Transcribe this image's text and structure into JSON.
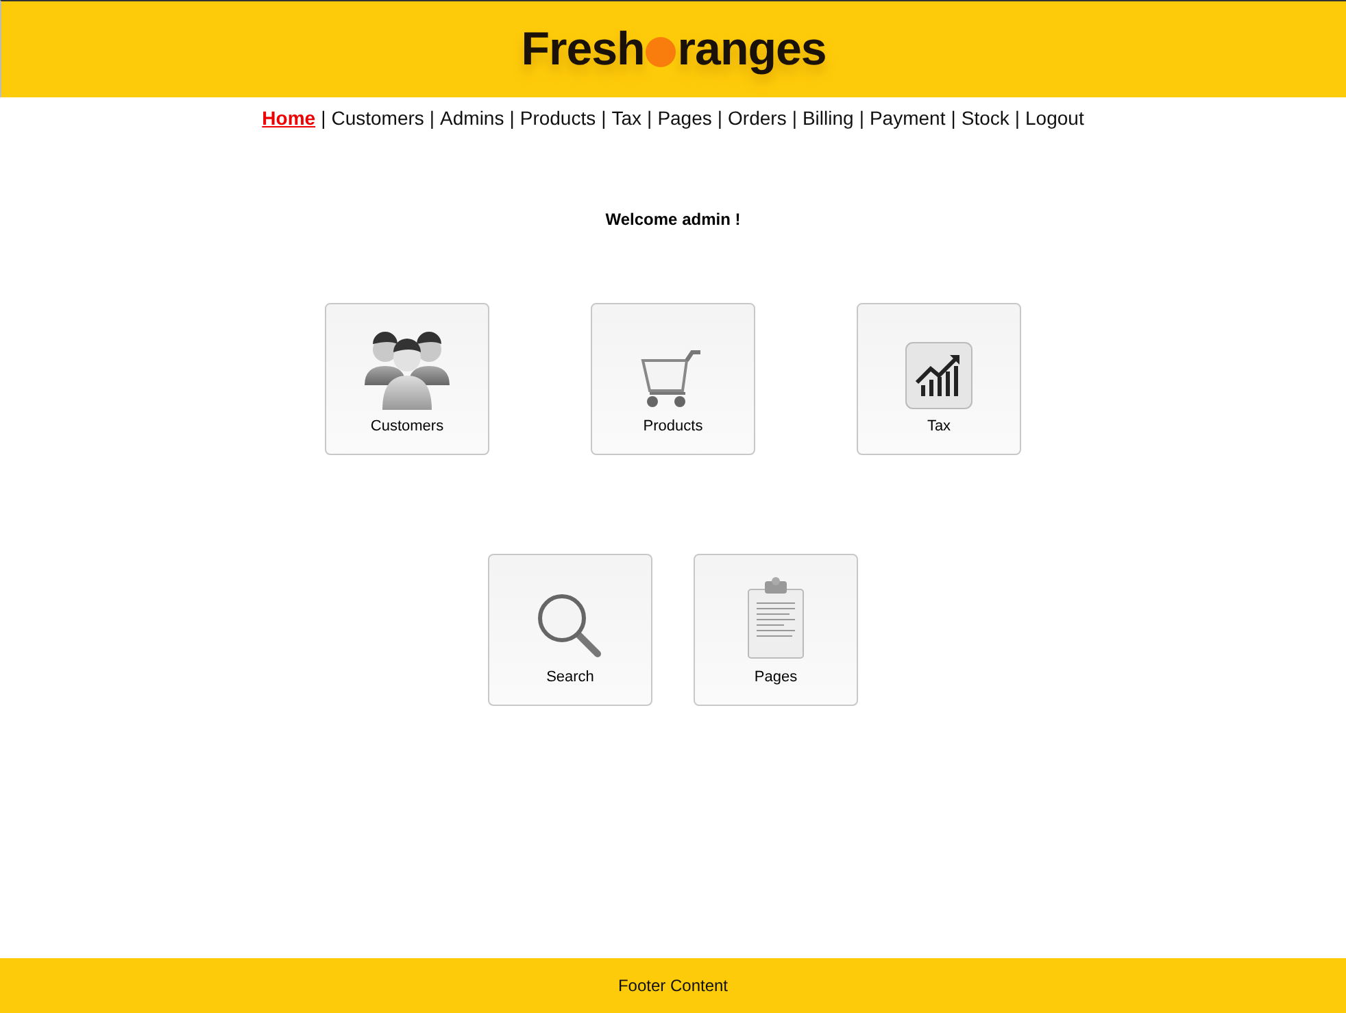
{
  "header": {
    "logo": {
      "before_dot": "Fresh",
      "after_dot": "ranges"
    }
  },
  "nav": {
    "separator": "|",
    "items": [
      {
        "label": "Home",
        "selected": true
      },
      {
        "label": "Customers",
        "selected": false
      },
      {
        "label": "Admins",
        "selected": false
      },
      {
        "label": "Products",
        "selected": false
      },
      {
        "label": "Tax",
        "selected": false
      },
      {
        "label": "Pages",
        "selected": false
      },
      {
        "label": "Orders",
        "selected": false
      },
      {
        "label": "Billing",
        "selected": false
      },
      {
        "label": "Payment",
        "selected": false
      },
      {
        "label": "Stock",
        "selected": false
      },
      {
        "label": "Logout",
        "selected": false
      }
    ]
  },
  "welcome": "Welcome admin !",
  "tile_rows": [
    [
      {
        "label": "Customers"
      },
      {
        "label": "Products"
      },
      {
        "label": "Tax"
      }
    ],
    [
      {
        "label": "Search"
      },
      {
        "label": "Pages"
      }
    ]
  ],
  "footer": "Footer Content"
}
